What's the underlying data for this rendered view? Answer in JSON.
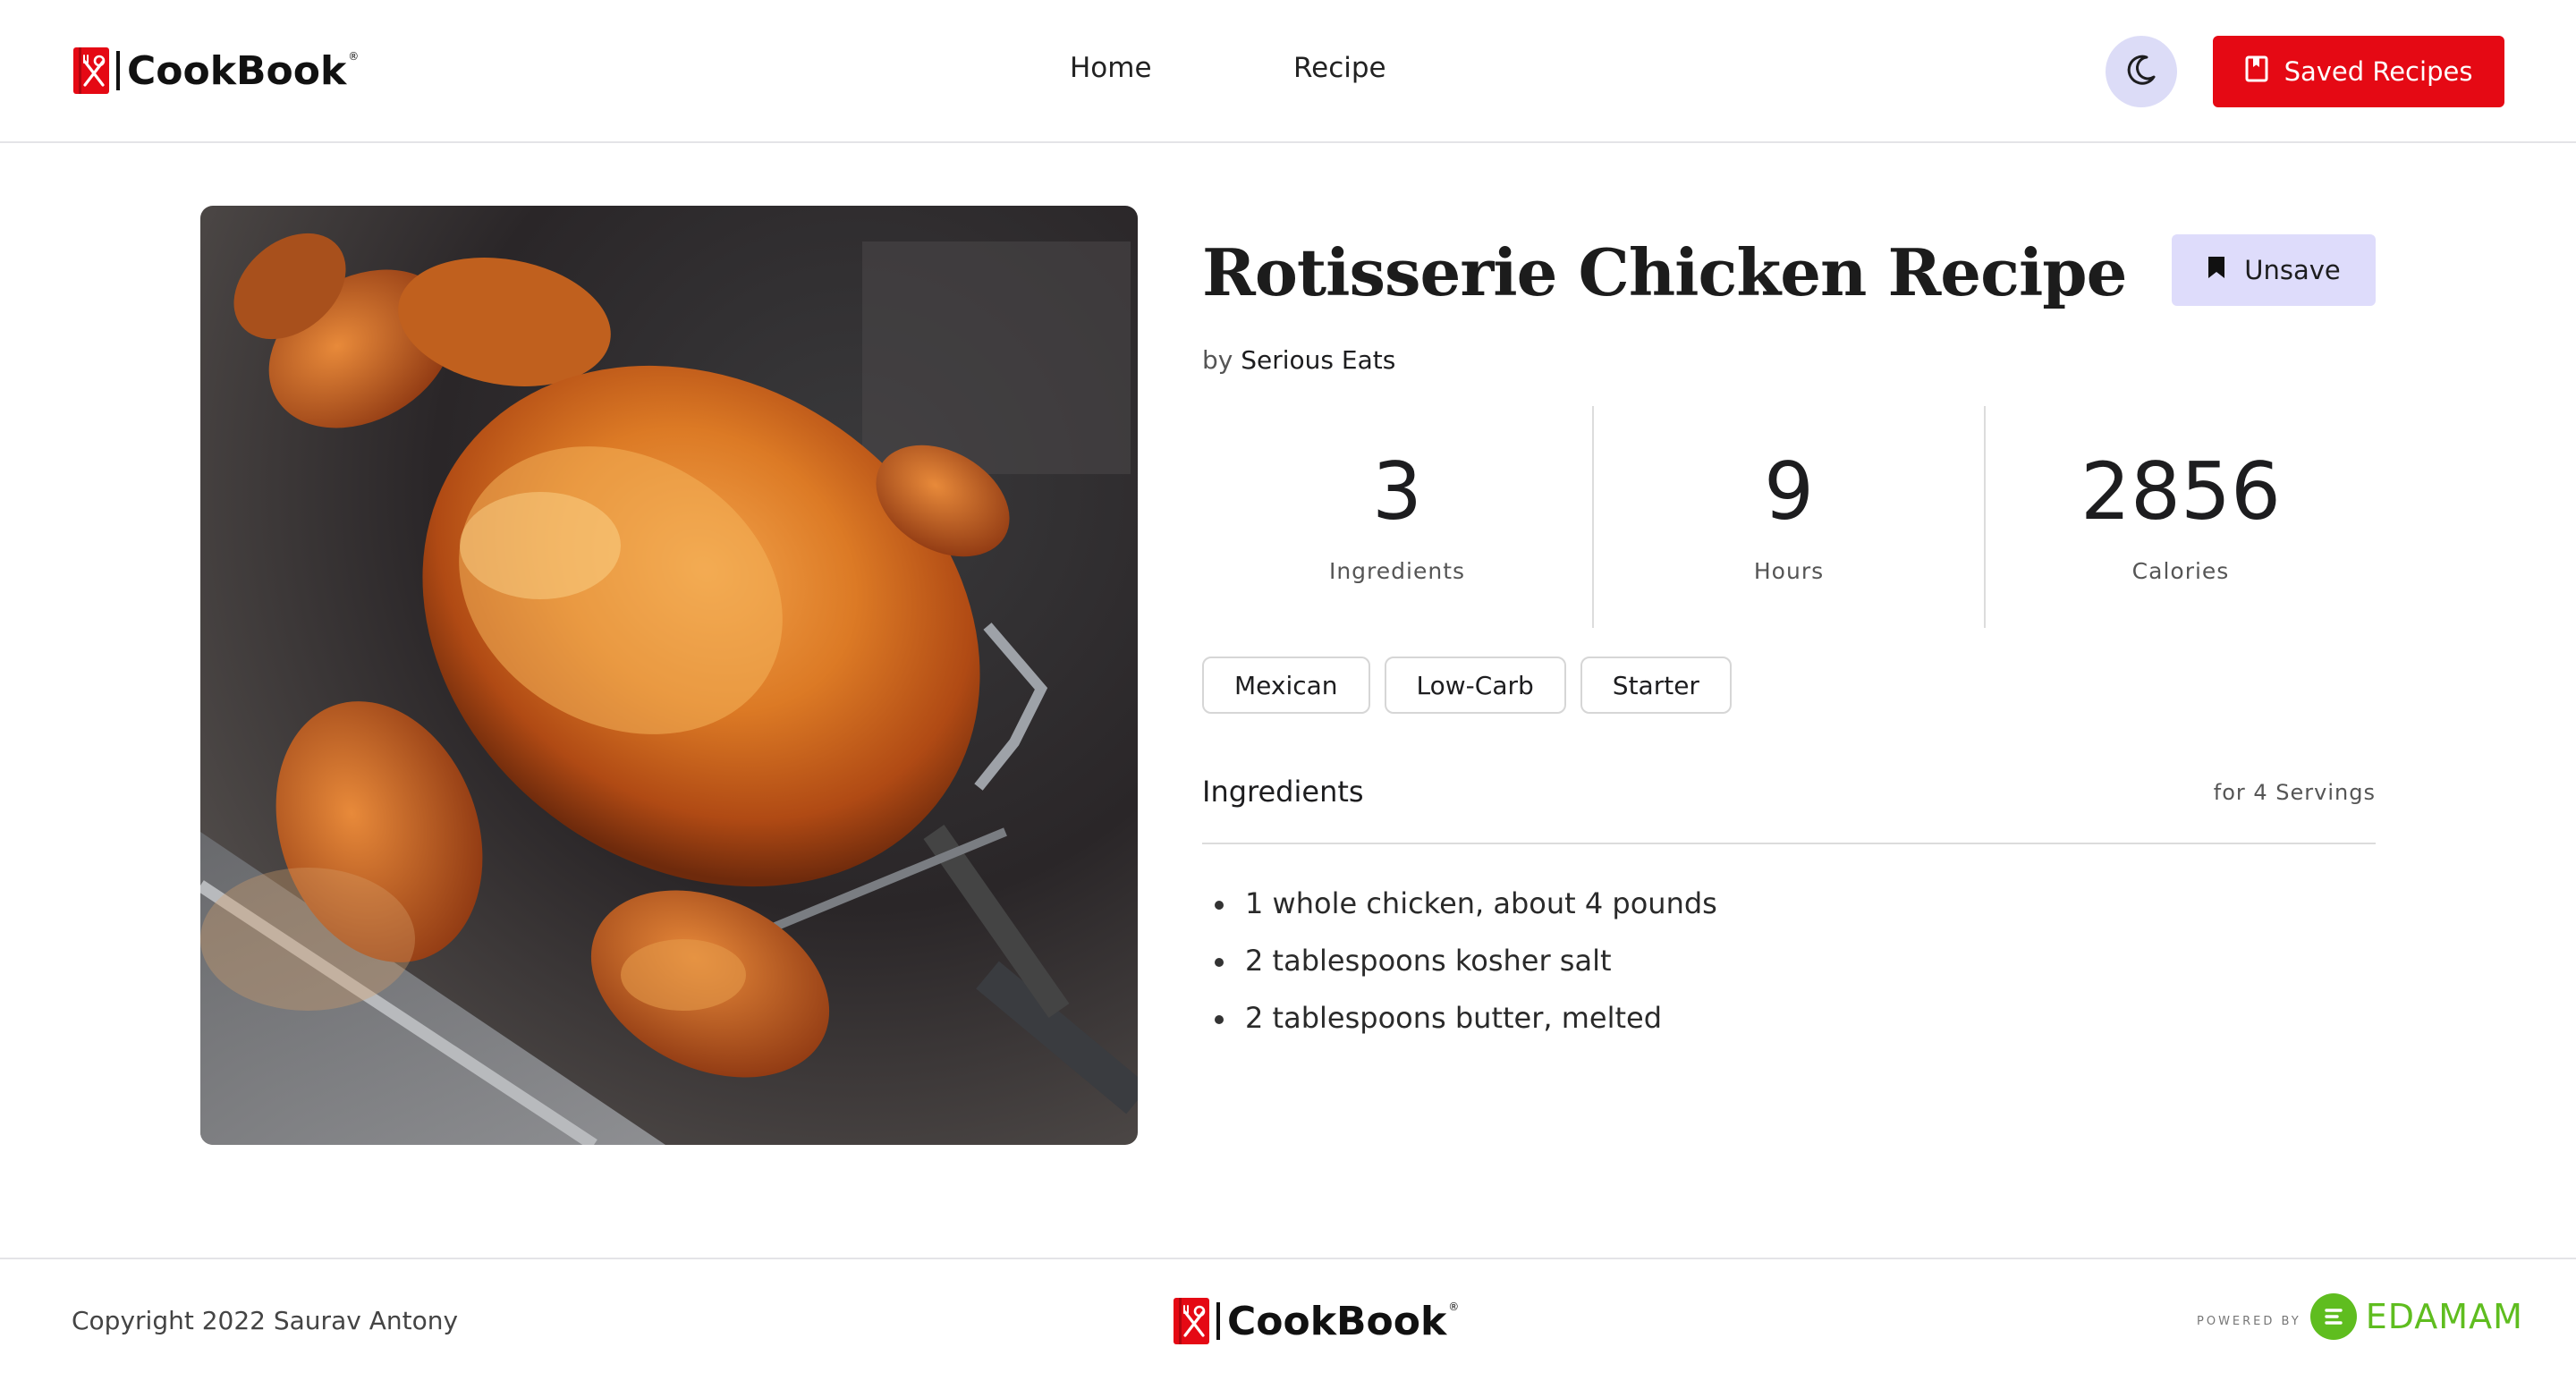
{
  "header": {
    "logo_text": "CookBook",
    "logo_reg": "®",
    "nav": [
      {
        "label": "Home"
      },
      {
        "label": "Recipe"
      }
    ],
    "theme_toggle_icon": "moon-icon",
    "saved_button_label": "Saved Recipes",
    "saved_button_icon": "book-icon"
  },
  "recipe": {
    "title": "Rotisserie Chicken Recipe",
    "by_prefix": "by",
    "author": "Serious Eats",
    "unsave_label": "Unsave",
    "unsave_icon": "bookmark-icon",
    "stats": [
      {
        "value": "3",
        "label": "Ingredients"
      },
      {
        "value": "9",
        "label": "Hours"
      },
      {
        "value": "2856",
        "label": "Calories"
      }
    ],
    "tags": [
      "Mexican",
      "Low-Carb",
      "Starter"
    ],
    "ingredients_heading": "Ingredients",
    "servings": "for 4 Servings",
    "ingredients": [
      "1 whole chicken, about 4 pounds",
      "2 tablespoons kosher salt",
      "2 tablespoons butter, melted"
    ],
    "image_subject": "rotisserie chicken on a spit"
  },
  "footer": {
    "copyright": "Copyright 2022 Saurav Antony",
    "logo_text": "CookBook",
    "logo_reg": "®",
    "powered_by": "POWERED BY",
    "partner": "EDAMAM"
  },
  "colors": {
    "brand_red": "#e50914",
    "unsave_bg": "#dedcfb",
    "toggle_bg": "#dcdcf7",
    "edamam_green": "#5fbd1f"
  }
}
